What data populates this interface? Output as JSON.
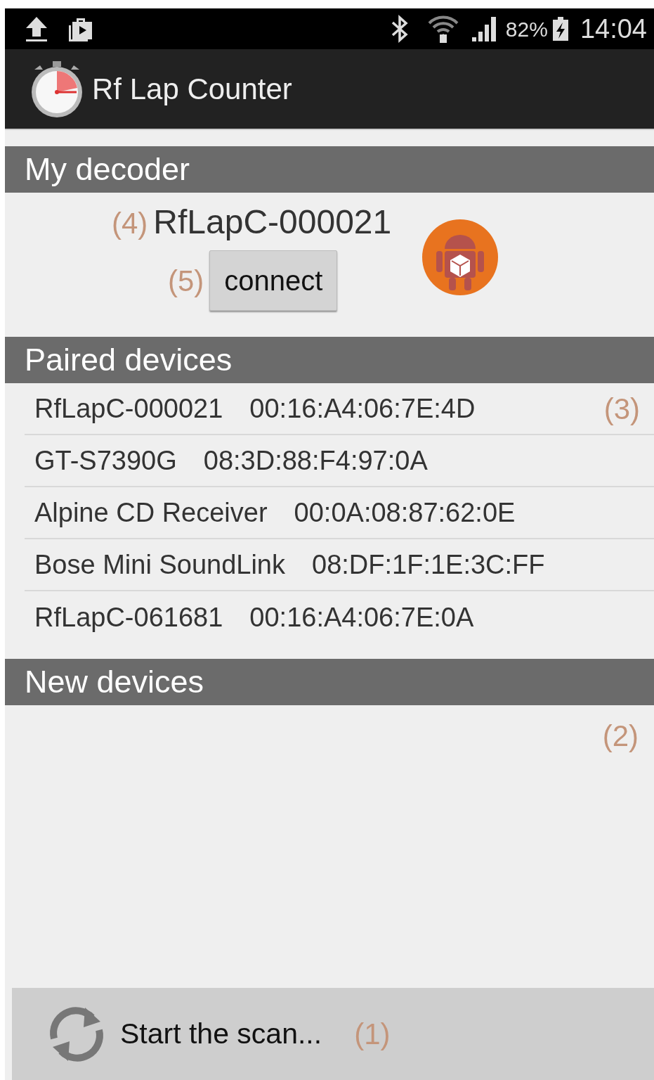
{
  "status_bar": {
    "battery": "82%",
    "time": "14:04"
  },
  "app_bar": {
    "title": "Rf Lap Counter"
  },
  "my_decoder": {
    "header": "My decoder",
    "name_note": "(4)",
    "name": "RfLapC-000021",
    "button_note": "(5)",
    "button": "connect"
  },
  "paired_devices": {
    "header": "Paired devices",
    "items": [
      {
        "name": "RfLapC-000021",
        "address": "00:16:A4:06:7E:4D",
        "note": "(3)"
      },
      {
        "name": "GT-S7390G",
        "address": "08:3D:88:F4:97:0A"
      },
      {
        "name": "Alpine CD Receiver",
        "address": "00:0A:08:87:62:0E"
      },
      {
        "name": "Bose Mini SoundLink",
        "address": "08:DF:1F:1E:3C:FF"
      },
      {
        "name": "RfLapC-061681",
        "address": "00:16:A4:06:7E:0A"
      }
    ]
  },
  "new_devices": {
    "header": "New devices",
    "note": "(2)"
  },
  "scan_button": {
    "label": "Start the scan...",
    "note": "(1)"
  }
}
